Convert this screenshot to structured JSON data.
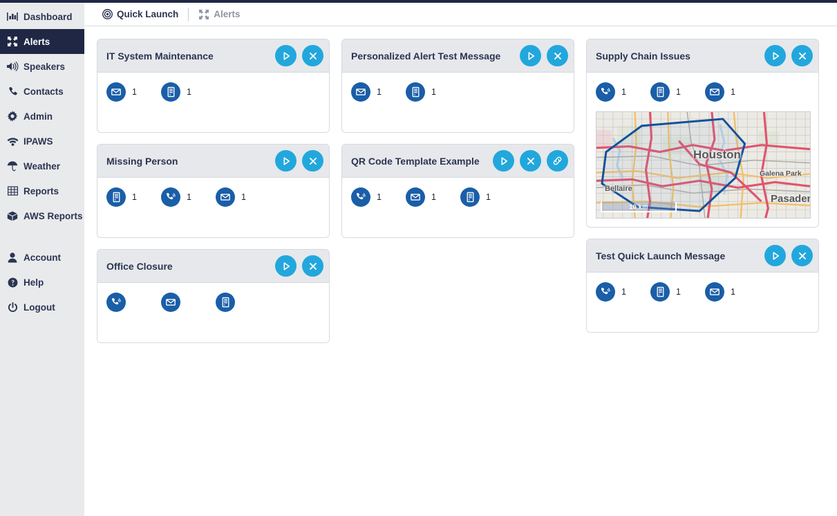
{
  "colors": {
    "sidebar_bg": "#e9eaec",
    "sidebar_active_bg": "#1f2744",
    "navy_text": "#2b3452",
    "action_button": "#22a7dd",
    "channel_icon": "#1a5ea8",
    "card_header_bg": "#e6e8eb",
    "card_border": "#d6d9de",
    "map_polygon": "#12519e"
  },
  "sidebar": {
    "items": [
      {
        "label": "Dashboard",
        "icon": "bar-chart-icon",
        "active": false
      },
      {
        "label": "Alerts",
        "icon": "alerts-icon",
        "active": true
      },
      {
        "label": "Speakers",
        "icon": "speaker-icon",
        "active": false
      },
      {
        "label": "Contacts",
        "icon": "phone-icon",
        "active": false
      },
      {
        "label": "Admin",
        "icon": "gear-icon",
        "active": false
      },
      {
        "label": "IPAWS",
        "icon": "wifi-icon",
        "active": false
      },
      {
        "label": "Weather",
        "icon": "umbrella-icon",
        "active": false
      },
      {
        "label": "Reports",
        "icon": "table-icon",
        "active": false
      },
      {
        "label": "AWS Reports",
        "icon": "box-icon",
        "active": false
      }
    ],
    "footer_items": [
      {
        "label": "Account",
        "icon": "user-icon"
      },
      {
        "label": "Help",
        "icon": "question-circle-icon"
      },
      {
        "label": "Logout",
        "icon": "power-icon"
      }
    ]
  },
  "tabs": [
    {
      "label": "Quick Launch",
      "icon": "target-icon",
      "active": true
    },
    {
      "label": "Alerts",
      "icon": "alerts-icon",
      "active": false
    }
  ],
  "cards": [
    {
      "id": "it-system-maintenance",
      "title": "IT System Maintenance",
      "column": 1,
      "actions": [
        {
          "name": "launch-button",
          "icon": "play-icon"
        },
        {
          "name": "cancel-button",
          "icon": "close-icon"
        }
      ],
      "channels": [
        {
          "icon": "email-icon",
          "count": "1"
        },
        {
          "icon": "desktop-icon",
          "count": "1"
        }
      ],
      "map": null
    },
    {
      "id": "missing-person",
      "title": "Missing Person",
      "column": 1,
      "actions": [
        {
          "name": "launch-button",
          "icon": "play-icon"
        },
        {
          "name": "cancel-button",
          "icon": "close-icon"
        }
      ],
      "channels": [
        {
          "icon": "desktop-icon",
          "count": "1"
        },
        {
          "icon": "phone-icon",
          "count": "1"
        },
        {
          "icon": "email-icon",
          "count": "1"
        }
      ],
      "map": null
    },
    {
      "id": "office-closure",
      "title": "Office Closure",
      "column": 1,
      "actions": [
        {
          "name": "launch-button",
          "icon": "play-icon"
        },
        {
          "name": "cancel-button",
          "icon": "close-icon"
        }
      ],
      "channels": [
        {
          "icon": "phone-icon",
          "count": ""
        },
        {
          "icon": "email-icon",
          "count": ""
        },
        {
          "icon": "desktop-icon",
          "count": ""
        }
      ],
      "map": null
    },
    {
      "id": "personalized-alert-test-message",
      "title": "Personalized Alert Test Message",
      "column": 2,
      "actions": [
        {
          "name": "launch-button",
          "icon": "play-icon"
        },
        {
          "name": "cancel-button",
          "icon": "close-icon"
        }
      ],
      "channels": [
        {
          "icon": "email-icon",
          "count": "1"
        },
        {
          "icon": "desktop-icon",
          "count": "1"
        }
      ],
      "map": null
    },
    {
      "id": "qr-code-template-example",
      "title": "QR Code Template Example",
      "column": 2,
      "actions": [
        {
          "name": "launch-button",
          "icon": "play-icon"
        },
        {
          "name": "cancel-button",
          "icon": "close-icon"
        },
        {
          "name": "link-button",
          "icon": "link-icon"
        }
      ],
      "channels": [
        {
          "icon": "phone-icon",
          "count": "1"
        },
        {
          "icon": "email-icon",
          "count": "1"
        },
        {
          "icon": "desktop-icon",
          "count": "1"
        }
      ],
      "map": null
    },
    {
      "id": "supply-chain-issues",
      "title": "Supply Chain Issues",
      "column": 3,
      "actions": [
        {
          "name": "launch-button",
          "icon": "play-icon"
        },
        {
          "name": "cancel-button",
          "icon": "close-icon"
        }
      ],
      "channels": [
        {
          "icon": "phone-icon",
          "count": "1"
        },
        {
          "icon": "desktop-icon",
          "count": "1"
        },
        {
          "icon": "email-icon",
          "count": "1"
        }
      ],
      "map": {
        "scale_label": "10 km",
        "place_labels": [
          "Houston",
          "Galena Park",
          "Bellaire",
          "Pasadena"
        ]
      }
    },
    {
      "id": "test-quick-launch-message",
      "title": "Test Quick Launch Message",
      "column": 3,
      "actions": [
        {
          "name": "launch-button",
          "icon": "play-icon"
        },
        {
          "name": "cancel-button",
          "icon": "close-icon"
        }
      ],
      "channels": [
        {
          "icon": "phone-icon",
          "count": "1"
        },
        {
          "icon": "desktop-icon",
          "count": "1"
        },
        {
          "icon": "email-icon",
          "count": "1"
        }
      ],
      "map": null
    }
  ]
}
